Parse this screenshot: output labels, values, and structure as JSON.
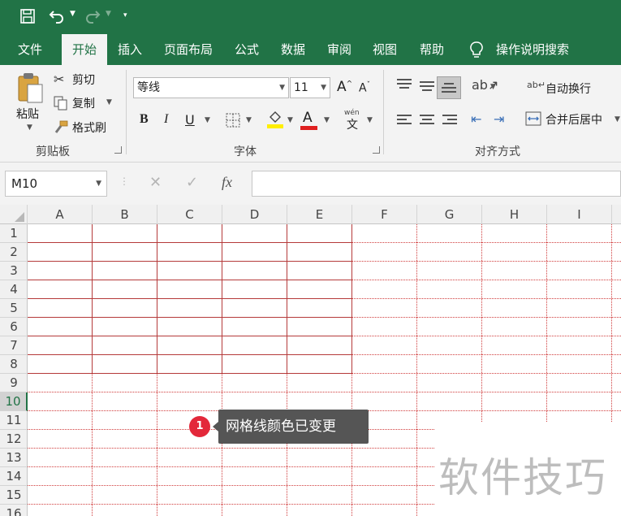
{
  "qat": {
    "save_icon": "save-icon",
    "undo_icon": "undo-icon",
    "redo_icon": "redo-icon",
    "customize_icon": "customize-qat-icon"
  },
  "tabs": [
    {
      "label": "文件"
    },
    {
      "label": "开始"
    },
    {
      "label": "插入"
    },
    {
      "label": "页面布局"
    },
    {
      "label": "公式"
    },
    {
      "label": "数据"
    },
    {
      "label": "审阅"
    },
    {
      "label": "视图"
    },
    {
      "label": "帮助"
    }
  ],
  "tell_me": {
    "label": "操作说明搜索",
    "icon": "lightbulb-icon"
  },
  "clipboard": {
    "paste": "粘贴",
    "cut": "剪切",
    "copy": "复制",
    "format_painter": "格式刷",
    "group_label": "剪贴板"
  },
  "font": {
    "name": "等线",
    "size": "11",
    "bold": "B",
    "italic": "I",
    "underline": "U",
    "font_color_letter": "A",
    "phonetic": "wén",
    "phonetic_char": "文",
    "group_label": "字体"
  },
  "alignment": {
    "wrap_text": "自动换行",
    "merge_center": "合并后居中",
    "group_label": "对齐方式"
  },
  "formula_bar": {
    "name_box": "M10",
    "fx": "fx",
    "cancel": "✕",
    "enter": "✓",
    "formula": ""
  },
  "grid": {
    "columns": [
      "A",
      "B",
      "C",
      "D",
      "E",
      "F",
      "G",
      "H",
      "I"
    ],
    "rows": [
      "1",
      "2",
      "3",
      "4",
      "5",
      "6",
      "7",
      "8",
      "9",
      "10",
      "11",
      "12",
      "13",
      "14",
      "15",
      "16"
    ],
    "active_row": "10",
    "gridline_color": "#d03c3c"
  },
  "callout": {
    "number": "1",
    "text": "网格线颜色已变更"
  },
  "watermark": "软件技巧"
}
